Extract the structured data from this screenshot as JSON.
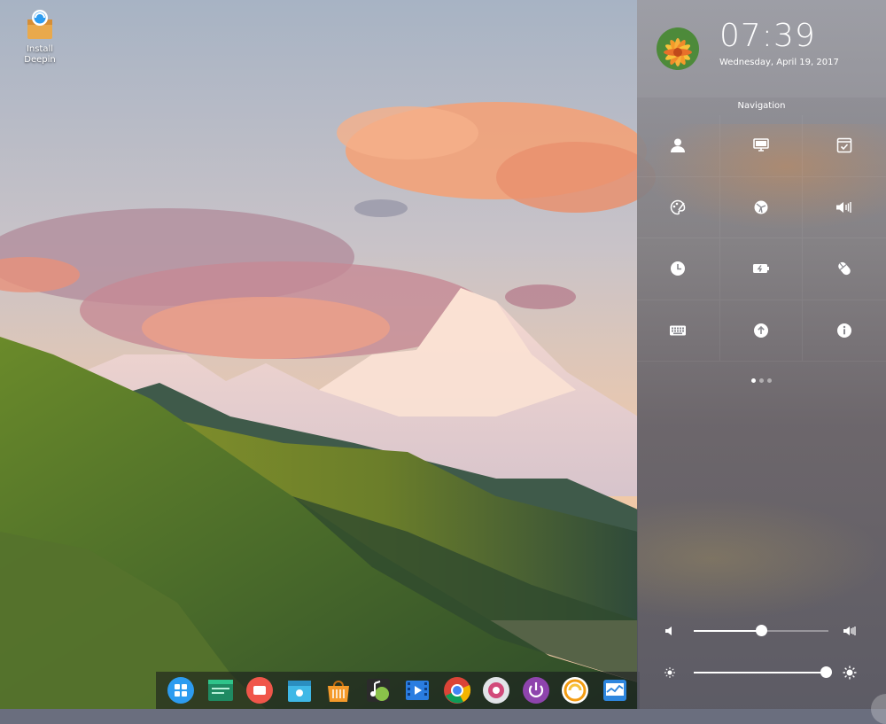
{
  "desktop": {
    "icon_label": "Install\nDeepin",
    "icon_name": "install-package-icon"
  },
  "dock": {
    "items": [
      {
        "name": "launcher-icon",
        "color": "#2d9cf0"
      },
      {
        "name": "terminal-icon",
        "color": "#2fc48a"
      },
      {
        "name": "screen-recorder-icon",
        "color": "#f0564a"
      },
      {
        "name": "file-manager-icon",
        "color": "#3fb8e6"
      },
      {
        "name": "app-store-icon",
        "color": "#f59a2a"
      },
      {
        "name": "music-player-icon",
        "color": "#8ac24a"
      },
      {
        "name": "movie-player-icon",
        "color": "#2a7de1"
      },
      {
        "name": "chrome-browser-icon",
        "color": "#dd4b39"
      },
      {
        "name": "control-center-icon",
        "color": "#e2e4e8"
      },
      {
        "name": "shutdown-icon",
        "color": "#8e44ad"
      },
      {
        "name": "backup-icon",
        "color": "#f39c12"
      },
      {
        "name": "system-monitor-icon",
        "color": "#2e86de"
      }
    ]
  },
  "control_center": {
    "time": "07:39",
    "date": "Wednesday, April 19, 2017",
    "section_title": "Navigation",
    "grid_icons": [
      "accounts-icon",
      "display-icon",
      "default-applications-icon",
      "personalization-icon",
      "network-icon",
      "sound-icon",
      "date-time-icon",
      "power-icon",
      "mouse-icon",
      "keyboard-icon",
      "update-icon",
      "system-info-icon"
    ],
    "pages": 3,
    "active_page": 0,
    "volume_level": 0.5,
    "brightness_level": 0.98,
    "accent_color": "#ffffff"
  }
}
